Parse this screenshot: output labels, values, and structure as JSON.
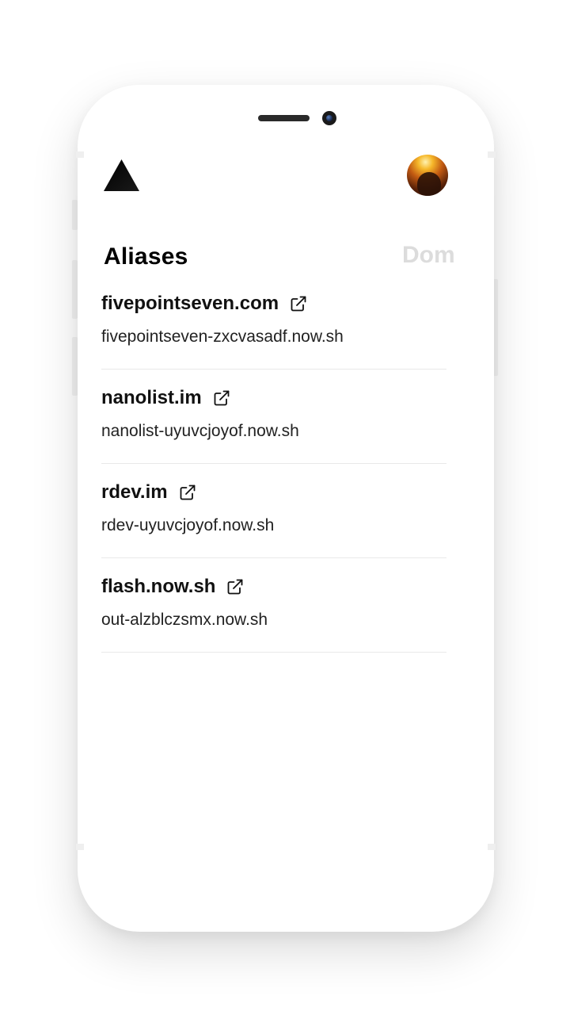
{
  "header": {
    "logo_icon": "triangle-logo-icon",
    "avatar_icon": "user-avatar"
  },
  "tabs": [
    {
      "label": "Aliases",
      "active": true
    },
    {
      "label": "Dom",
      "active": false
    }
  ],
  "aliases": [
    {
      "domain": "fivepointseven.com",
      "target": "fivepointseven-zxcvasadf.now.sh",
      "icon": "external-link-icon"
    },
    {
      "domain": "nanolist.im",
      "target": "nanolist-uyuvcjoyof.now.sh",
      "icon": "external-link-icon"
    },
    {
      "domain": "rdev.im",
      "target": "rdev-uyuvcjoyof.now.sh",
      "icon": "external-link-icon"
    },
    {
      "domain": "flash.now.sh",
      "target": "out-alzblczsmx.now.sh",
      "icon": "external-link-icon"
    }
  ],
  "colors": {
    "active_tab": "#000000",
    "inactive_tab": "#dcdcdc",
    "divider": "#e9e9e9"
  }
}
